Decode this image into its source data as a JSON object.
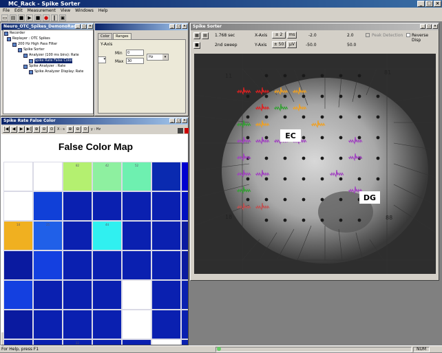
{
  "app": {
    "title": "MC_Rack - Spike Sorter"
  },
  "menu": [
    "File",
    "Edit",
    "Measurement",
    "View",
    "Windows",
    "Help"
  ],
  "toolbar_icons": [
    "new-icon",
    "open-icon",
    "save-icon",
    "play-icon",
    "stop-icon",
    "record-icon",
    "pause-icon",
    "view-icon"
  ],
  "rack": {
    "title": "Neuro_OTC_Spikes_DemonoRack",
    "tree": [
      {
        "label": "Recorder",
        "level": 0,
        "icon": "recorder-icon"
      },
      {
        "label": "Replayer : OTC Spikes",
        "level": 1,
        "icon": "replayer-icon"
      },
      {
        "label": "200 Hz High Pass Filter",
        "level": 2,
        "icon": "filter-icon"
      },
      {
        "label": "Spike Sorter",
        "level": 3,
        "icon": "sorter-icon"
      },
      {
        "label": "Analyzer (100 ms bins): Rate",
        "level": 4,
        "icon": "analyzer-icon"
      },
      {
        "label": "Spike Rate False Color",
        "level": 5,
        "icon": "color-icon",
        "selected": true
      },
      {
        "label": "Spike Analyzer : Rate",
        "level": 4,
        "icon": "analyzer-icon"
      },
      {
        "label": "Spike Analyzer Display: Rate",
        "level": 5,
        "icon": "display-icon"
      }
    ],
    "tabs": [
      "Color",
      "Ranges"
    ],
    "active_tab": "Ranges",
    "yaxis_label": "Y-Axis",
    "min_label": "Min",
    "min_value": "0",
    "max_label": "Max",
    "max_value": "30",
    "unit": "Hz"
  },
  "fcm": {
    "title": "Spike Rate False Color",
    "heading": "False Color Map",
    "x_unit_label": "X : s",
    "y_unit_label": "y : Hz",
    "cells": [
      {
        "label": "",
        "color": "#ffffff"
      },
      {
        "label": "",
        "color": "#ffffff"
      },
      {
        "label": "82",
        "color": "#b4f070"
      },
      {
        "label": "42",
        "color": "#8ef0a0"
      },
      {
        "label": "52",
        "color": "#6ef0b0"
      },
      {
        "label": "",
        "color": "#0a2ab0"
      },
      {
        "label": "",
        "color": "#0000d0"
      },
      {
        "label": "",
        "color": "#ffffff"
      },
      {
        "label": "",
        "color": "#ffffff"
      },
      {
        "label": "",
        "color": "#1040d8"
      },
      {
        "label": "",
        "color": "#0a20b0"
      },
      {
        "label": "",
        "color": "#0a20b0"
      },
      {
        "label": "",
        "color": "#0a20b0"
      },
      {
        "label": "",
        "color": "#0a20b0"
      },
      {
        "label": "",
        "color": "#0010c0"
      },
      {
        "label": "",
        "color": "#ffffff"
      },
      {
        "label": "14",
        "color": "#f0b020"
      },
      {
        "label": "25",
        "color": "#2060e8"
      },
      {
        "label": "",
        "color": "#0a20b0"
      },
      {
        "label": "44",
        "color": "#30f0f0"
      },
      {
        "label": "",
        "color": "#0a20b0"
      },
      {
        "label": "",
        "color": "#0a20b0"
      },
      {
        "label": "",
        "color": "#0a1aa0"
      },
      {
        "label": "",
        "color": "#ffffff"
      },
      {
        "label": "",
        "color": "#0a1aa0"
      },
      {
        "label": "",
        "color": "#1440e0"
      },
      {
        "label": "",
        "color": "#0a20b0"
      },
      {
        "label": "",
        "color": "#0a20b0"
      },
      {
        "label": "",
        "color": "#0a20b0"
      },
      {
        "label": "",
        "color": "#0a20b0"
      },
      {
        "label": "",
        "color": "#0a1aa0"
      },
      {
        "label": "",
        "color": "#ffffff"
      },
      {
        "label": "",
        "color": "#1440e0"
      },
      {
        "label": "",
        "color": "#0a20b0"
      },
      {
        "label": "",
        "color": "#0a20b0"
      },
      {
        "label": "",
        "color": "#0a20b0"
      },
      {
        "label": "",
        "color": "#ffffff"
      },
      {
        "label": "",
        "color": "#0a20b0"
      },
      {
        "label": "",
        "color": "#0a20b0"
      },
      {
        "label": "",
        "color": "#1a30e0"
      },
      {
        "label": "",
        "color": "#0a1aa0"
      },
      {
        "label": "",
        "color": "#0a20b0"
      },
      {
        "label": "",
        "color": "#0a20b0"
      },
      {
        "label": "",
        "color": "#0a20b0"
      },
      {
        "label": "",
        "color": "#ffffff"
      },
      {
        "label": "",
        "color": "#0a20b0"
      },
      {
        "label": "",
        "color": "#0a20b0"
      },
      {
        "label": "",
        "color": "#0a20b0"
      },
      {
        "label": "",
        "color": "#0a20b0"
      },
      {
        "label": "",
        "color": "#0a20b0"
      },
      {
        "label": "22",
        "color": "#0a20b0"
      },
      {
        "label": "",
        "color": "#0a20b0"
      },
      {
        "label": "",
        "color": "#0a20b0"
      },
      {
        "label": "",
        "color": "#ffffff"
      },
      {
        "label": "",
        "color": "#0a20b0"
      },
      {
        "label": "",
        "color": "#ffffff"
      }
    ]
  },
  "spike_sorter": {
    "title": "Spike Sorter",
    "time": "1.768 sec",
    "sweep": "2nd sweep",
    "xaxis_label": "X-Axis",
    "xaxis_value": "± 2",
    "xaxis_unit": "ms",
    "yaxis_label": "Y-Axis",
    "yaxis_value": "± 50",
    "yaxis_unit": "µV",
    "thr1_min": "-2.0",
    "thr1_max": "2.0",
    "thr2_min": "-50.0",
    "thr2_max": "50.0",
    "peak_detection_label": "Peak Detection",
    "reverse_disp_label": "Reverse Disp",
    "electrode_labels": {
      "tl": "11",
      "tr": "81",
      "bl": "18",
      "br": "88"
    },
    "regions": {
      "ec": "EC",
      "dg": "DG"
    },
    "trace_colors": [
      "#e02020",
      "#f0a020",
      "#30a030",
      "#a040c0",
      "#c05050"
    ]
  },
  "status": {
    "text": "For Help, press F1",
    "num": "NUM"
  }
}
